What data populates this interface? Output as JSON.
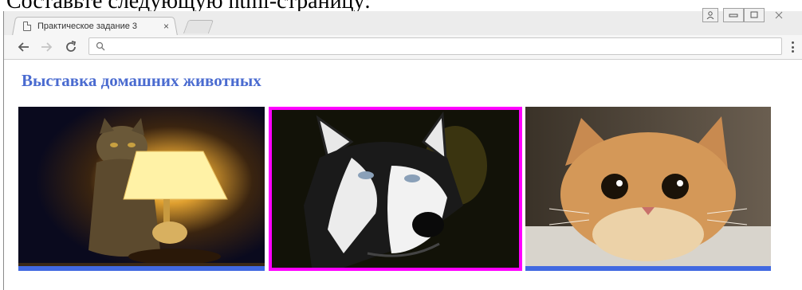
{
  "doc_caption": "Составьте следующую html-страницу:",
  "browser": {
    "tab_title": "Практическое задание 3",
    "tab_close": "×",
    "window_buttons": [
      "я",
      "–",
      "▢",
      "✕"
    ]
  },
  "toolbar": {
    "back_icon": "arrow-left-icon",
    "forward_icon": "arrow-right-icon",
    "reload_icon": "reload-icon",
    "address_value": "",
    "menu_icon": "more-vert-icon"
  },
  "page": {
    "heading": "Выставка домашних животных",
    "heading_color": "#4a6bd0",
    "gallery": [
      {
        "subject": "cat-with-lamp",
        "highlighted": false,
        "bar_color": "#4169e1"
      },
      {
        "subject": "husky-dog",
        "highlighted": true,
        "border_color": "#ff00ff"
      },
      {
        "subject": "ginger-cat",
        "highlighted": false,
        "bar_color": "#4169e1"
      }
    ]
  }
}
